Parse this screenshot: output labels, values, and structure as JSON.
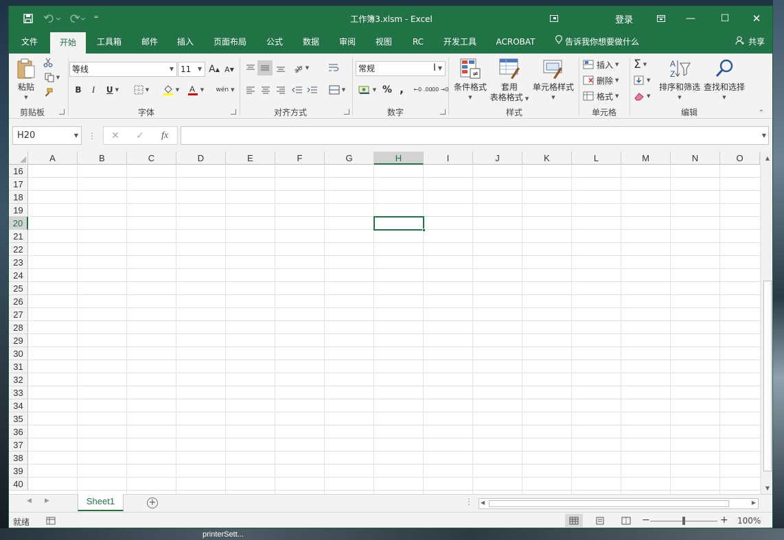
{
  "window": {
    "title": "工作簿3.xlsm  -  Excel",
    "login": "登录",
    "minimize": "—",
    "restore": "☐",
    "close": "✕"
  },
  "qat": {
    "customize": "⁼"
  },
  "tabs": [
    {
      "label": "文件"
    },
    {
      "label": "开始"
    },
    {
      "label": "工具箱"
    },
    {
      "label": "邮件"
    },
    {
      "label": "插入"
    },
    {
      "label": "页面布局"
    },
    {
      "label": "公式"
    },
    {
      "label": "数据"
    },
    {
      "label": "审阅"
    },
    {
      "label": "视图"
    },
    {
      "label": "RC"
    },
    {
      "label": "开发工具"
    },
    {
      "label": "ACROBAT"
    }
  ],
  "tell_me": "告诉我你想要做什么",
  "share": "共享",
  "clipboard": {
    "paste": "粘贴",
    "group": "剪贴板"
  },
  "font": {
    "name": "等线",
    "size": "11",
    "grow": "A",
    "shrink": "A",
    "bold": "B",
    "italic": "I",
    "underline": "U",
    "phonetic": "wén",
    "group": "字体"
  },
  "align": {
    "group": "对齐方式"
  },
  "number": {
    "format": "常规",
    "percent": "%",
    "comma": ",",
    "inc_decimal": "←0 .00",
    "dec_decimal": ".00 →0",
    "group": "数字"
  },
  "styles": {
    "conditional": "条件格式",
    "table_line1": "套用",
    "table_line2": "表格格式",
    "cell": "单元格样式",
    "group": "样式"
  },
  "cells": {
    "insert": "插入",
    "delete": "删除",
    "format": "格式",
    "group": "单元格"
  },
  "editing": {
    "sum": "Σ",
    "sort": "排序和筛选",
    "find": "查找和选择",
    "group": "编辑"
  },
  "formula_bar": {
    "name_box": "H20",
    "cancel": "✕",
    "enter": "✓",
    "fx": "fx",
    "value": ""
  },
  "grid": {
    "columns": [
      "A",
      "B",
      "C",
      "D",
      "E",
      "F",
      "G",
      "H",
      "I",
      "J",
      "K",
      "L",
      "M",
      "N",
      "O"
    ],
    "selected_column": "H",
    "rows": [
      "16",
      "17",
      "18",
      "19",
      "20",
      "21",
      "22",
      "23",
      "24",
      "25",
      "26",
      "27",
      "28",
      "29",
      "30",
      "31",
      "32",
      "33",
      "34",
      "35",
      "36",
      "37",
      "38",
      "39",
      "40"
    ],
    "selected_row": "20",
    "active_cell": "H20"
  },
  "sheets": {
    "tabs": [
      "Sheet1"
    ],
    "add": "+"
  },
  "status": {
    "ready": "就绪",
    "zoom": "100%",
    "minus": "−",
    "plus": "+"
  },
  "desktop": {
    "taskbar_label": "printerSett..."
  },
  "colors": {
    "accent": "#217346",
    "selection": "#217346",
    "gridline": "#e1e1e1"
  }
}
